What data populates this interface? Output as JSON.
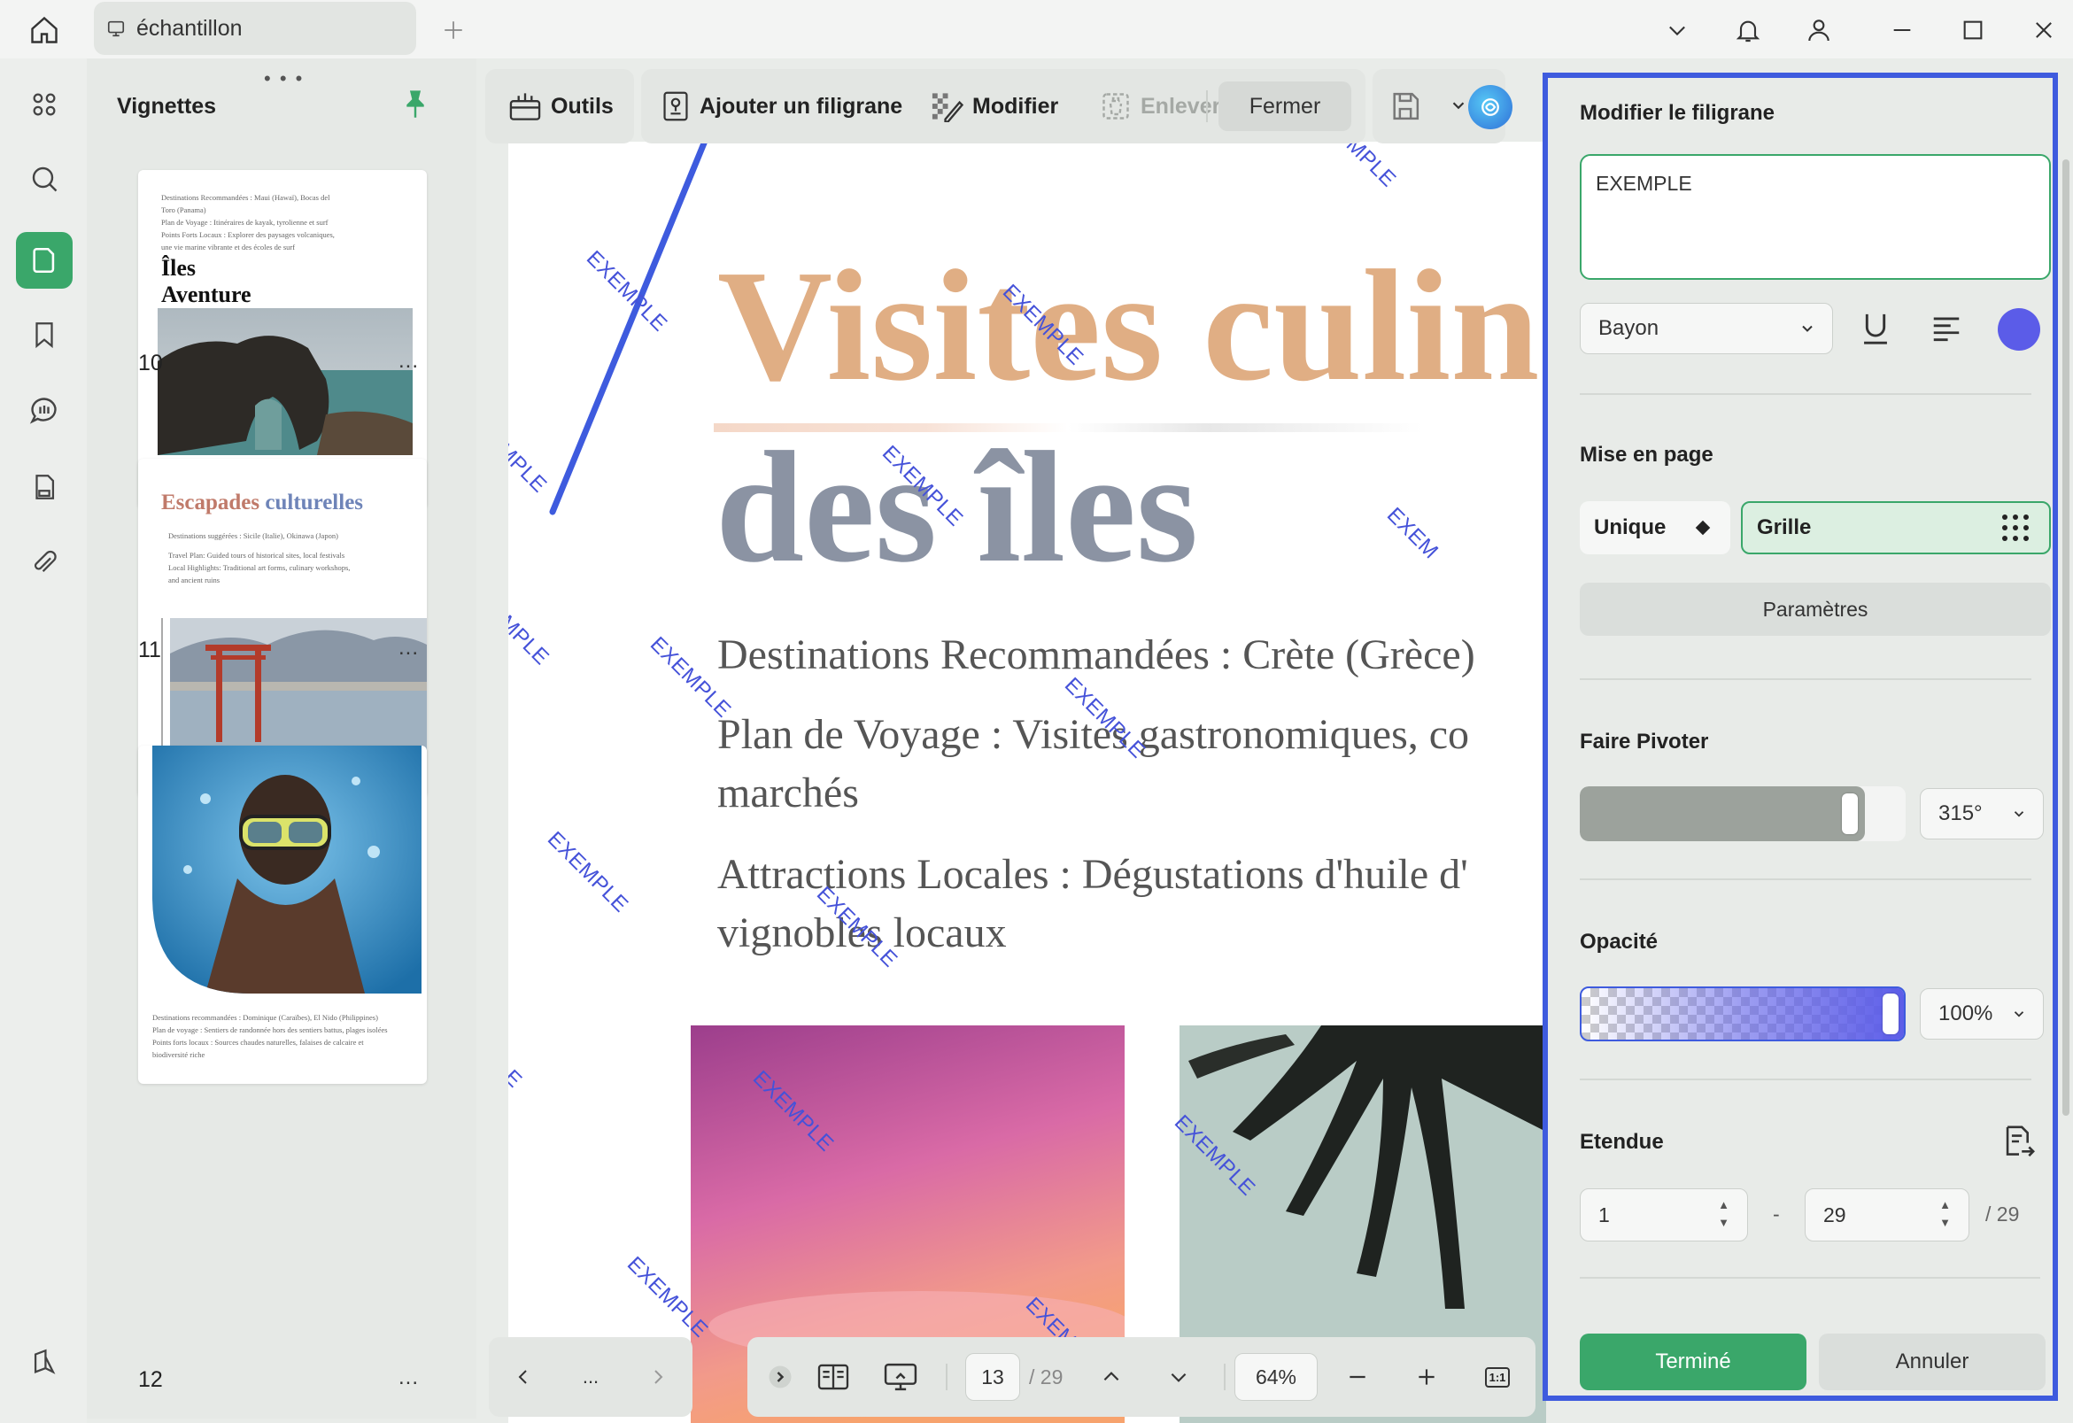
{
  "titlebar": {
    "tab_title": "échantillon"
  },
  "thumbnails": {
    "title": "Vignettes",
    "pages": [
      {
        "number": "10",
        "lines": [
          "Destinations Recommandées : Maui (Hawaï), Bocas del",
          "Toro (Panama)",
          "Plan de Voyage : Itinéraires de kayak, tyrolienne et surf",
          "Points Forts Locaux : Explorer des paysages volcaniques,",
          "une vie marine vibrante et des écoles de surf"
        ],
        "title1": "Îles",
        "title2": "Aventure"
      },
      {
        "number": "11",
        "title_a": "Escapades",
        "title_b": "culturelles",
        "lines": [
          "Destinations suggérées : Sicile (Italie), Okinawa (Japon)",
          "Travel Plan: Guided tours of historical sites, local festivals",
          "Local Highlights: Traditional art forms, culinary workshops,",
          "and ancient ruins"
        ]
      },
      {
        "number": "12",
        "lines": [
          "Destinations recommandées : Dominique (Caraïbes), El Nido (Philippines)",
          "Plan de voyage : Sentiers de randonnée hors des sentiers battus, plages isolées",
          "Points forts locaux : Sources chaudes naturelles, falaises de calcaire et",
          "biodiversité riche"
        ]
      }
    ],
    "more": "..."
  },
  "toolbar": {
    "tools_label": "Outils",
    "add_watermark_label": "Ajouter un filigrane",
    "modify_label": "Modifier",
    "remove_label": "Enlever",
    "close_label": "Fermer"
  },
  "document": {
    "title_line1": "Visites culin",
    "title_line2": "des îles",
    "para1": "Destinations Recommandées : Crète (Grèce)",
    "para2a": "Plan de Voyage : Visites gastronomiques, co",
    "para2b": "marchés",
    "para3a": "Attractions Locales : Dégustations d'huile d'",
    "para3b": "vignobles locaux",
    "watermark_text": "EXEMPLE",
    "watermark_fragments": {
      "top_right": "MPLE",
      "left_edge": "EMPLE",
      "right_edge": "EXEM",
      "bottom": "EXEM"
    }
  },
  "bottom_nav": {
    "more": "...",
    "current_page": "13",
    "total_pages": "/ 29",
    "zoom": "64%",
    "fit_label": "1:1"
  },
  "panel": {
    "title": "Modifier le filigrane",
    "watermark_text": "EXEMPLE",
    "font": "Bayon",
    "color": "#5b5ce8",
    "layout_title": "Mise en page",
    "layout_single": "Unique",
    "layout_grid": "Grille",
    "layout_selected": "Grille",
    "params_label": "Paramètres",
    "rotate_title": "Faire Pivoter",
    "rotate_value": "315°",
    "rotate_fraction": 0.875,
    "opacity_title": "Opacité",
    "opacity_value": "100%",
    "opacity_fraction": 1.0,
    "range_title": "Etendue",
    "range_from": "1",
    "range_separator": "-",
    "range_to": "29",
    "range_total": "/ 29",
    "done_label": "Terminé",
    "cancel_label": "Annuler"
  },
  "colors": {
    "accent": "#3aa76a",
    "panel_border": "#3e5bde",
    "watermark": "#4552d9",
    "title_orange": "#e0ae84",
    "title_gray": "#8b93a3"
  }
}
